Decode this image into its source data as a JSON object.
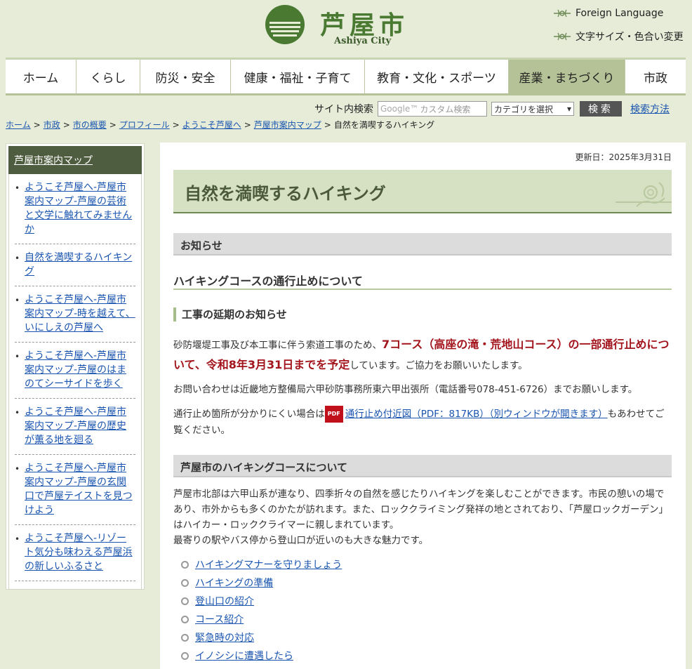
{
  "header": {
    "logo_ja": "芦屋市",
    "logo_en": "Ashiya City",
    "foreign_language": "Foreign Language",
    "font_color": "文字サイズ・色合い変更"
  },
  "nav": [
    {
      "label": "ホーム",
      "active": false
    },
    {
      "label": "くらし",
      "active": false
    },
    {
      "label": "防災・安全",
      "active": false
    },
    {
      "label": "健康・福祉・子育て",
      "active": false
    },
    {
      "label": "教育・文化・スポーツ",
      "active": false
    },
    {
      "label": "産業・まちづくり",
      "active": true
    },
    {
      "label": "市政",
      "active": false
    }
  ],
  "search": {
    "label": "サイト内検索",
    "placeholder": "カスタム検索",
    "google": "Google™",
    "category": "カテゴリを選択",
    "button": "検索",
    "how": "検索方法"
  },
  "breadcrumb": {
    "items": [
      "ホーム",
      "市政",
      "市の概要",
      "プロフィール",
      "ようこそ芦屋へ",
      "芦屋市案内マップ"
    ],
    "current": "自然を満喫するハイキング"
  },
  "sidebar": {
    "title": "芦屋市案内マップ",
    "items": [
      {
        "label": "ようこそ芦屋へ-芦屋市案内マップ-芦屋の芸術と文学に触れてみませんか"
      },
      {
        "label": "自然を満喫するハイキング"
      },
      {
        "label": "ようこそ芦屋へ-芦屋市案内マップ-時を越えて、いにしえの芦屋へ"
      },
      {
        "label": "ようこそ芦屋へ-芦屋市案内マップ-芦屋のはまのてシーサイドを歩く"
      },
      {
        "label": "ようこそ芦屋へ-芦屋市案内マップ-芦屋の歴史が薫る地を廻る"
      },
      {
        "label": "ようこそ芦屋へ-芦屋市案内マップ-芦屋の玄関口で芦屋テイストを見つけよう"
      },
      {
        "label": "ようこそ芦屋へ-リゾート気分も味わえる芦屋浜の新しいふるさと"
      }
    ]
  },
  "main": {
    "updated": "更新日：2025年3月31日",
    "title": "自然を満喫するハイキング",
    "notice_heading": "お知らせ",
    "closure_heading": "ハイキングコースの通行止めについて",
    "delay_heading": "工事の延期のお知らせ",
    "p1_a": "砂防堰堤工事及び本工事に伴う索道工事のため、",
    "p1_red": "7コース（高座の滝・荒地山コース）の一部通行止めについて、令和8年3月31日までを予定",
    "p1_b": "しています。ご協力をお願いいたします。",
    "p2": "お問い合わせは近畿地方整備局六甲砂防事務所東六甲出張所（電話番号078-451-6726）までお願いします。",
    "p3_a": "通行止め箇所が分かりにくい場合は",
    "pdf_badge": "PDF",
    "p3_link": "通行止め付近図（PDF：817KB）（別ウィンドウが開きます）",
    "p3_b": "もあわせてご覧ください。",
    "courses_heading": "芦屋市のハイキングコースについて",
    "p4": "芦屋市北部は六甲山系が連なり、四季折々の自然を感じたりハイキングを楽しむことができます。市民の憩いの場であり、市外からも多くのかたが訪れます。また、ロッククライミング発祥の地とされており、「芦屋ロックガーデン」はハイカー・ロッククライマーに親しまれています。",
    "p5": "最寄りの駅やバス停から登山口が近いのも大きな魅力です。",
    "links": [
      {
        "label": "ハイキングマナーを守りましょう"
      },
      {
        "label": "ハイキングの準備"
      },
      {
        "label": "登山口の紹介"
      },
      {
        "label": "コース紹介"
      },
      {
        "label": "緊急時の対応"
      },
      {
        "label": "イノシシに遭遇したら"
      }
    ]
  },
  "colors": {
    "page_bg": "#e6ecd8",
    "brand_green": "#4a7a32",
    "nav_active": "#b5c196",
    "sidebar_head": "#4e5c3f",
    "alert_red": "#a3151d",
    "link": "#1a55b0"
  }
}
